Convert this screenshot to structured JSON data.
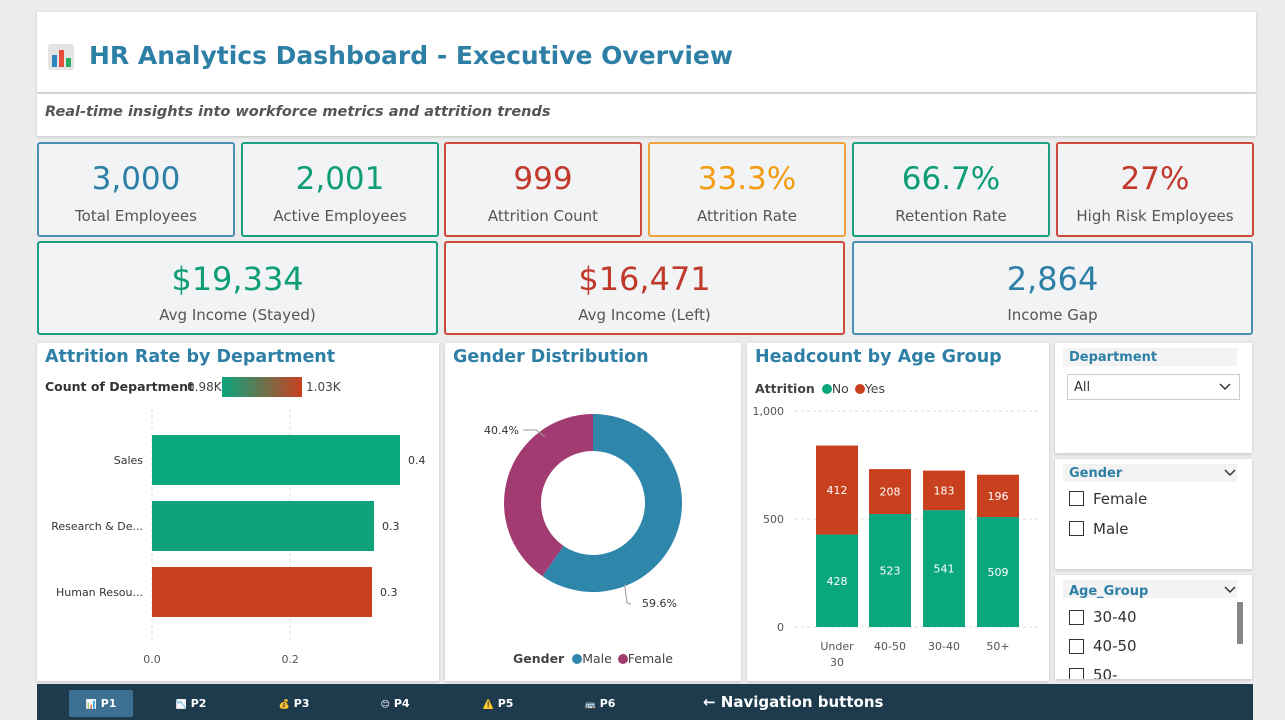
{
  "header": {
    "icon": "bar-chart-icon",
    "title": "HR Analytics Dashboard - Executive Overview",
    "subtitle": "Real-time insights into workforce metrics and attrition trends"
  },
  "kpis": [
    {
      "value": "3,000",
      "label": "Total Employees",
      "color": "#2e7fa6",
      "border": "#4a8fb5"
    },
    {
      "value": "2,001",
      "label": "Active Employees",
      "color": "#0f9d76",
      "border": "#19a07e"
    },
    {
      "value": "999",
      "label": "Attrition Count",
      "color": "#c0392b",
      "border": "#cf4a3c"
    },
    {
      "value": "33.3%",
      "label": "Attrition Rate",
      "color": "#f39c12",
      "border": "#f0a33a"
    },
    {
      "value": "66.7%",
      "label": "Retention Rate",
      "color": "#0f9d76",
      "border": "#19a07e"
    },
    {
      "value": "27%",
      "label": "High Risk Employees",
      "color": "#c0392b",
      "border": "#cf4a3c"
    }
  ],
  "income_kpis": [
    {
      "value": "$19,334",
      "label": "Avg Income (Stayed)",
      "color": "#0f9d76",
      "border": "#19a07e"
    },
    {
      "value": "$16,471",
      "label": "Avg Income (Left)",
      "color": "#c0392b",
      "border": "#cf4a3c"
    },
    {
      "value": "2,864",
      "label": "Income Gap",
      "color": "#2e7fa6",
      "border": "#4a8fb5"
    }
  ],
  "dept_chart": {
    "title": "Attrition Rate by Department",
    "legend_title": "Count of Department",
    "legend_min": "0.98K",
    "legend_max": "1.03K",
    "x_ticks": [
      "0.0",
      "0.2"
    ]
  },
  "gender_chart": {
    "title": "Gender Distribution",
    "legend_title": "Gender",
    "legend_items": [
      "Male",
      "Female"
    ]
  },
  "age_chart": {
    "title": "Headcount by Age Group",
    "legend_title": "Attrition",
    "legend_items": [
      "No",
      "Yes"
    ],
    "y_ticks": [
      "1,000",
      "500",
      "0"
    ],
    "cat_lines": [
      [
        "Under",
        "30"
      ],
      [
        "40-50"
      ],
      [
        "30-40"
      ],
      [
        "50+"
      ]
    ]
  },
  "chart_data": [
    {
      "type": "bar",
      "orientation": "horizontal",
      "title": "Attrition Rate by Department",
      "categories": [
        "Sales",
        "Research & De...",
        "Human Resou..."
      ],
      "values": [
        0.4,
        0.3,
        0.3
      ],
      "colors": [
        "#0aa67e",
        "#10a27a",
        "#c9401f"
      ],
      "xlim": [
        0,
        0.44
      ]
    },
    {
      "type": "pie",
      "title": "Gender Distribution",
      "labels": [
        "Male",
        "Female"
      ],
      "values": [
        59.6,
        40.4
      ],
      "value_labels": [
        "59.6%",
        "40.4%"
      ],
      "colors": [
        "#2e86ab",
        "#a23b72"
      ]
    },
    {
      "type": "bar",
      "stacked": true,
      "title": "Headcount by Age Group",
      "categories": [
        "Under 30",
        "40-50",
        "30-40",
        "50+"
      ],
      "series": [
        {
          "name": "No",
          "values": [
            428,
            523,
            541,
            509
          ],
          "color": "#0aa67e"
        },
        {
          "name": "Yes",
          "values": [
            412,
            208,
            183,
            196
          ],
          "color": "#c9401f"
        }
      ],
      "ylim": [
        0,
        1000
      ]
    }
  ],
  "slicers": {
    "department": {
      "title": "Department",
      "selected": "All"
    },
    "gender": {
      "title": "Gender",
      "options": [
        "Female",
        "Male"
      ]
    },
    "age_group": {
      "title": "Age_Group",
      "options": [
        "30-40",
        "40-50",
        "50-"
      ]
    }
  },
  "nav": {
    "buttons": [
      {
        "icon": "📊",
        "label": "P1"
      },
      {
        "icon": "📉",
        "label": "P2"
      },
      {
        "icon": "💰",
        "label": "P3"
      },
      {
        "icon": "😊",
        "label": "P4"
      },
      {
        "icon": "⚠️",
        "label": "P5"
      },
      {
        "icon": "🚌",
        "label": "P6"
      }
    ],
    "hint": "← Navigation buttons"
  }
}
